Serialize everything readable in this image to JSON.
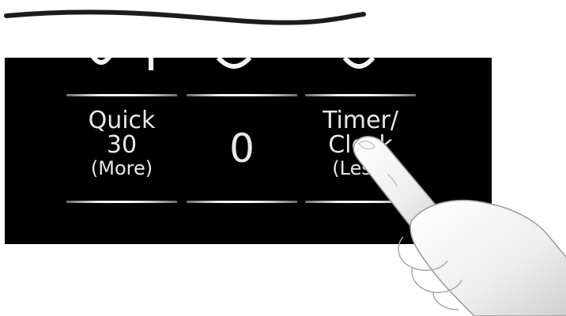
{
  "panel": {
    "buttons": [
      {
        "line1": "Quick",
        "line2": "30",
        "line3": "(More)"
      },
      {
        "digit": "0"
      },
      {
        "line1": "Timer/",
        "line2": "Clock",
        "line3": "(Less)"
      }
    ]
  },
  "icons": {
    "hand": "pointing-hand-icon"
  }
}
